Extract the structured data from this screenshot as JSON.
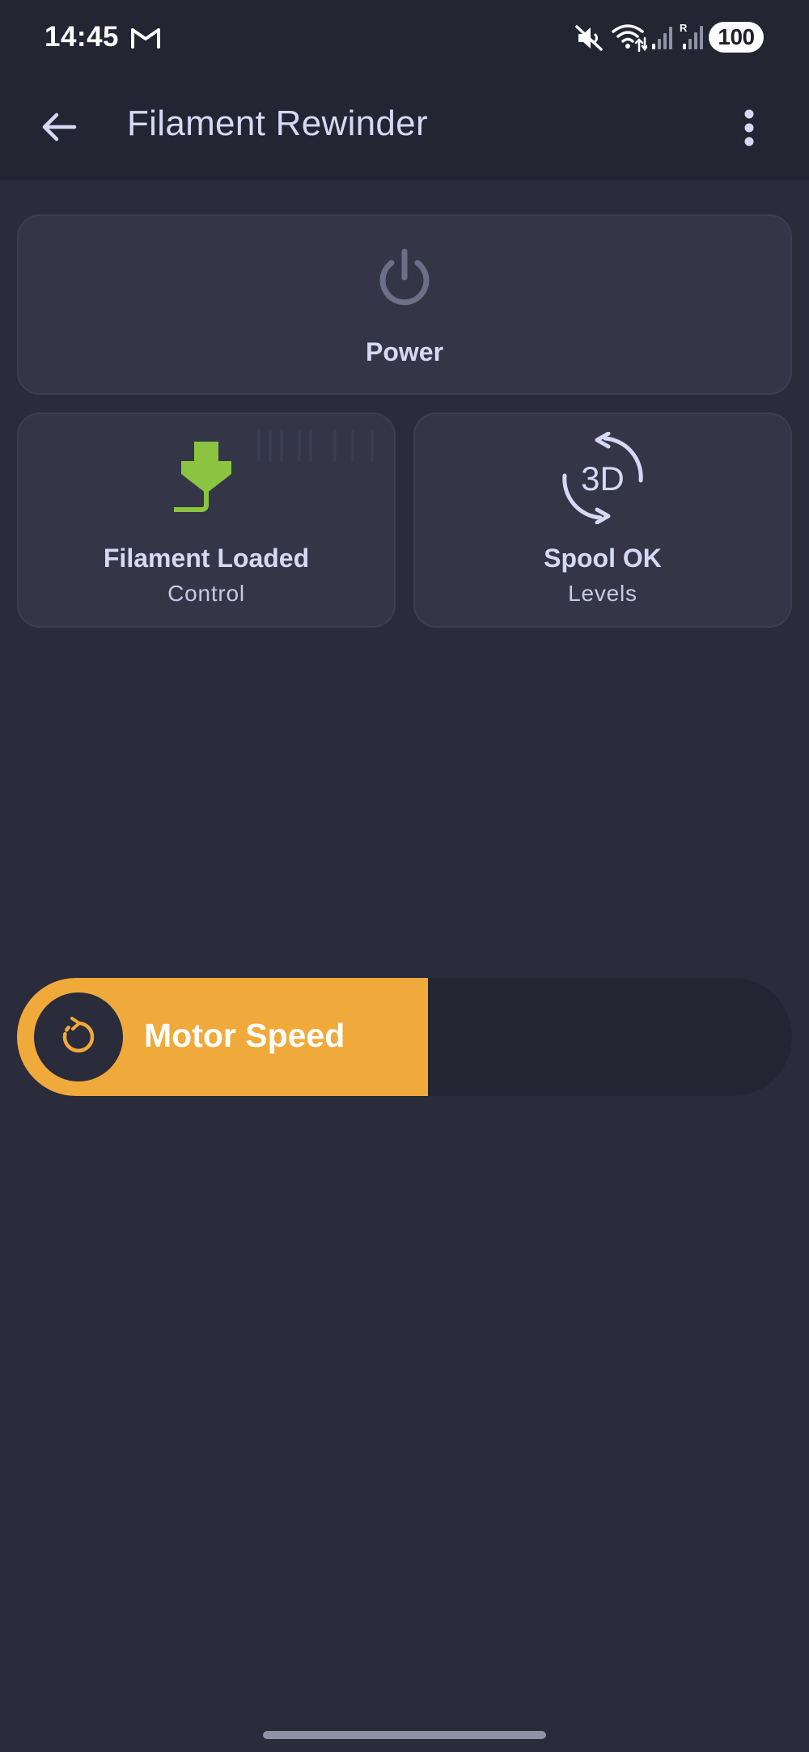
{
  "status_bar": {
    "time": "14:45",
    "battery": "100",
    "icons": [
      "gmail-icon",
      "mute-icon",
      "wifi-icon",
      "signal-icon",
      "signal-roaming-icon"
    ]
  },
  "app_bar": {
    "title": "Filament Rewinder",
    "back_icon": "arrow-back-icon",
    "menu_icon": "more-vert-icon"
  },
  "tiles": {
    "power": {
      "label": "Power",
      "icon": "power-icon",
      "icon_color": "#6c6f88"
    },
    "filament": {
      "label": "Filament Loaded",
      "sublabel": "Control",
      "icon": "filament-load-icon",
      "icon_color": "#8bc440"
    },
    "spool": {
      "label": "Spool OK",
      "sublabel": "Levels",
      "icon": "rotate-3d-icon",
      "icon_color": "#d6d9f5"
    }
  },
  "motor_slider": {
    "label": "Motor Speed",
    "level_percent": 53,
    "icon": "rotate-speed-icon",
    "fill_color": "#f0a93b"
  },
  "colors": {
    "background": "#2a2b3b",
    "top_band": "#242533",
    "tile": "#343648",
    "text": "#d6d9f5",
    "accent": "#f0a93b"
  }
}
